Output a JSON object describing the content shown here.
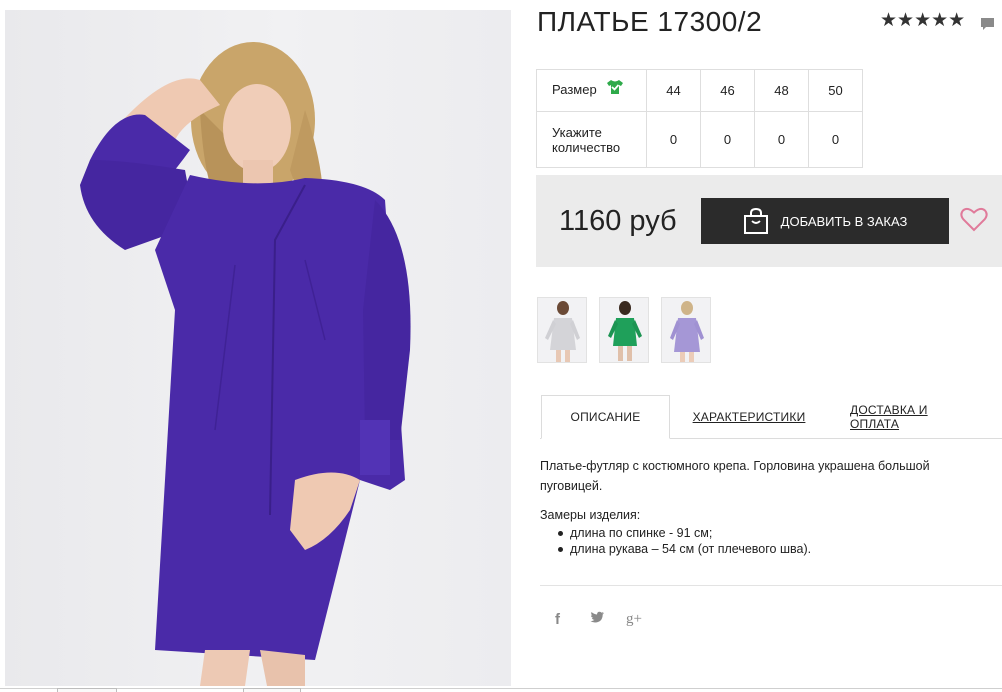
{
  "product": {
    "title": "ПЛАТЬЕ 17300/2",
    "rating_stars": "★★★★★",
    "price": "1160 руб",
    "colors": {
      "dress": "#4a2aa8",
      "button": "#2b2b2b",
      "heart": "#e07a9a",
      "check": "#2eaa4a"
    }
  },
  "size_table": {
    "size_label": "Размер",
    "qty_label_line1": "Укажите",
    "qty_label_line2": "количество",
    "sizes": [
      "44",
      "46",
      "48",
      "50"
    ],
    "quantities": [
      "0",
      "0",
      "0",
      "0"
    ]
  },
  "order": {
    "button_label": "ДОБАВИТЬ В ЗАКАЗ"
  },
  "tabs": [
    {
      "label": "ОПИСАНИЕ"
    },
    {
      "label": "ХАРАКТЕРИСТИКИ"
    },
    {
      "label": "ДОСТАВКА И ОПЛАТА"
    }
  ],
  "description": {
    "text": "Платье-футляр с костюмного крепа. Горловина украшена большой пуговицей.",
    "measurements_title": "Замеры изделия:",
    "measurements": [
      "длина по спинке - 91 см;",
      "длина рукава – 54 см (от плечевого шва)."
    ]
  },
  "social": {
    "facebook": "f",
    "twitter": "t",
    "google": "g+"
  },
  "icons": [
    "star-icon",
    "comment-icon",
    "shirt-check-icon",
    "bag-icon",
    "heart-icon",
    "facebook-icon",
    "twitter-icon",
    "google-plus-icon"
  ]
}
